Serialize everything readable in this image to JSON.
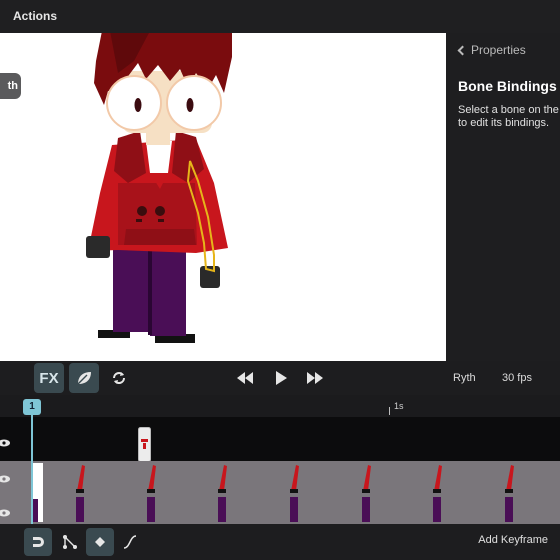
{
  "topbar": {
    "actions_label": "Actions"
  },
  "canvas": {
    "layer_pill_label": "th"
  },
  "panel": {
    "back_label": "Properties",
    "title": "Bone Bindings",
    "description": "Select a bone on the canvas to edit its bindings."
  },
  "transport": {
    "fx_label": "FX",
    "character_name": "Ryth",
    "fps_label": "30 fps"
  },
  "timeline": {
    "playhead_frame": "1",
    "second_marker": "1s"
  },
  "bottombar": {
    "add_keyframe_label": "Add Keyframe"
  },
  "colors": {
    "accent": "#7fc6d6",
    "hoodie": "#c8161d",
    "pants": "#4a0e56",
    "hair": "#7a0c0e",
    "skin": "#f6e0c4",
    "bone_highlight": "#e6b51a"
  }
}
